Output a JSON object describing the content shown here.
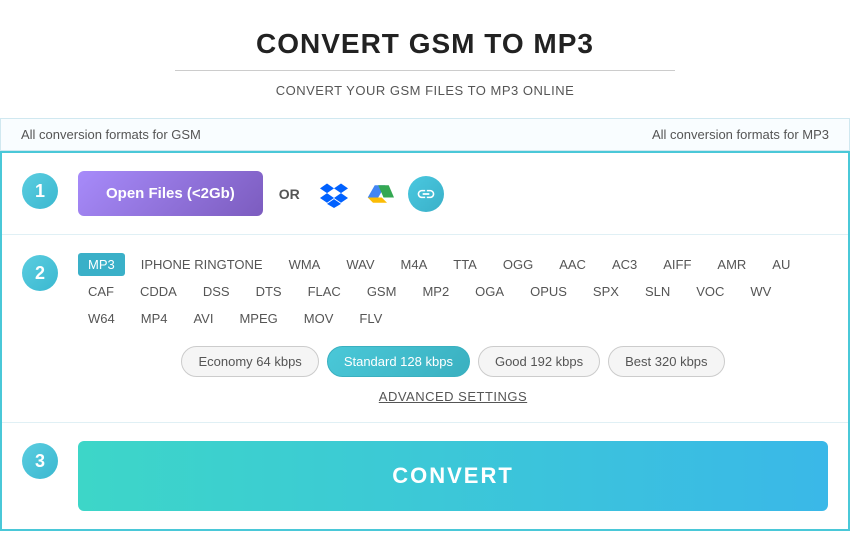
{
  "header": {
    "title": "CONVERT GSM TO MP3",
    "divider": true,
    "subtitle": "CONVERT YOUR GSM FILES TO MP3 ONLINE"
  },
  "nav": {
    "left": "All conversion formats for GSM",
    "right": "All conversion formats for MP3"
  },
  "step1": {
    "number": "1",
    "open_files_label": "Open Files (<2Gb)",
    "or_label": "OR"
  },
  "step2": {
    "number": "2",
    "formats": [
      {
        "label": "MP3",
        "active": true
      },
      {
        "label": "IPHONE RINGTONE",
        "active": false
      },
      {
        "label": "WMA",
        "active": false
      },
      {
        "label": "WAV",
        "active": false
      },
      {
        "label": "M4A",
        "active": false
      },
      {
        "label": "TTA",
        "active": false
      },
      {
        "label": "OGG",
        "active": false
      },
      {
        "label": "AAC",
        "active": false
      },
      {
        "label": "AC3",
        "active": false
      },
      {
        "label": "AIFF",
        "active": false
      },
      {
        "label": "AMR",
        "active": false
      },
      {
        "label": "AU",
        "active": false
      },
      {
        "label": "CAF",
        "active": false
      },
      {
        "label": "CDDA",
        "active": false
      },
      {
        "label": "DSS",
        "active": false
      },
      {
        "label": "DTS",
        "active": false
      },
      {
        "label": "FLAC",
        "active": false
      },
      {
        "label": "GSM",
        "active": false
      },
      {
        "label": "MP2",
        "active": false
      },
      {
        "label": "OGA",
        "active": false
      },
      {
        "label": "OPUS",
        "active": false
      },
      {
        "label": "SPX",
        "active": false
      },
      {
        "label": "SLN",
        "active": false
      },
      {
        "label": "VOC",
        "active": false
      },
      {
        "label": "WV",
        "active": false
      },
      {
        "label": "W64",
        "active": false
      },
      {
        "label": "MP4",
        "active": false
      },
      {
        "label": "AVI",
        "active": false
      },
      {
        "label": "MPEG",
        "active": false
      },
      {
        "label": "MOV",
        "active": false
      },
      {
        "label": "FLV",
        "active": false
      }
    ],
    "qualities": [
      {
        "label": "Economy 64 kbps",
        "active": false
      },
      {
        "label": "Standard 128 kbps",
        "active": true
      },
      {
        "label": "Good 192 kbps",
        "active": false
      },
      {
        "label": "Best 320 kbps",
        "active": false
      }
    ],
    "advanced_label": "ADVANCED SETTINGS"
  },
  "step3": {
    "number": "3",
    "convert_label": "CONVERT"
  }
}
